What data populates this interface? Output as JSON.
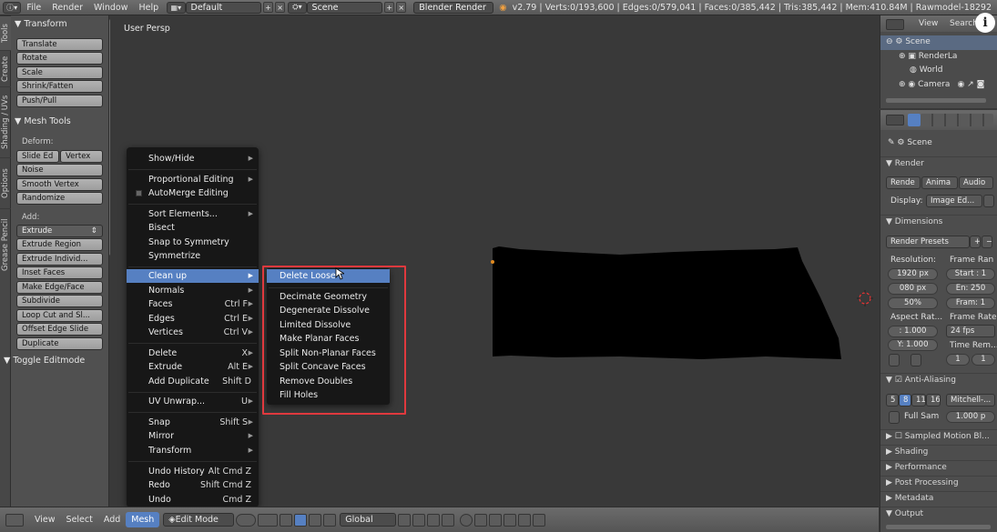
{
  "topbar": {
    "menus": [
      "File",
      "Render",
      "Window",
      "Help"
    ],
    "layout": "Default",
    "scene": "Scene",
    "engine": "Blender Render",
    "stats": "v2.79 | Verts:0/193,600 | Edges:0/579,041 | Faces:0/385,442 | Tris:385,442 | Mem:410.84M | Rawmodel-18292"
  },
  "sidetabs": [
    "Tools",
    "Create",
    "Shading / UVs",
    "Options",
    "Grease Pencil"
  ],
  "toolshelf": {
    "transform_header": "Transform",
    "transform_buttons": [
      "Translate",
      "Rotate",
      "Scale",
      "Shrink/Fatten",
      "Push/Pull"
    ],
    "meshtools_header": "Mesh Tools",
    "deform_label": "Deform:",
    "deform_pair": [
      "Slide Ed",
      "Vertex"
    ],
    "deform_buttons": [
      "Noise",
      "Smooth Vertex",
      "Randomize"
    ],
    "add_label": "Add:",
    "add_selected": "Extrude",
    "add_buttons": [
      "Extrude Region",
      "Extrude Individ...",
      "Inset Faces",
      "Make Edge/Face",
      "Subdivide",
      "Loop Cut and Sl...",
      "Offset Edge Slide",
      "Duplicate"
    ],
    "toggle_editmode": "Toggle Editmode"
  },
  "viewport": {
    "label": "User Persp"
  },
  "mesh_menu": {
    "items": [
      {
        "label": "Show/Hide",
        "shortcut": "",
        "submenu": true
      },
      {
        "label": "Proportional Editing",
        "shortcut": "",
        "submenu": true
      },
      {
        "label": "AutoMerge Editing",
        "shortcut": "",
        "submenu": false
      },
      {
        "label": "Sort Elements...",
        "shortcut": "",
        "submenu": true
      },
      {
        "label": "Bisect",
        "shortcut": "",
        "submenu": false
      },
      {
        "label": "Snap to Symmetry",
        "shortcut": "",
        "submenu": false
      },
      {
        "label": "Symmetrize",
        "shortcut": "",
        "submenu": false
      },
      {
        "label": "Clean up",
        "shortcut": "",
        "submenu": true
      },
      {
        "label": "Normals",
        "shortcut": "",
        "submenu": true
      },
      {
        "label": "Faces",
        "shortcut": "Ctrl F",
        "submenu": true
      },
      {
        "label": "Edges",
        "shortcut": "Ctrl E",
        "submenu": true
      },
      {
        "label": "Vertices",
        "shortcut": "Ctrl V",
        "submenu": true
      },
      {
        "label": "Delete",
        "shortcut": "X",
        "submenu": true
      },
      {
        "label": "Extrude",
        "shortcut": "Alt E",
        "submenu": true
      },
      {
        "label": "Add Duplicate",
        "shortcut": "Shift D",
        "submenu": false
      },
      {
        "label": "UV Unwrap...",
        "shortcut": "U",
        "submenu": true
      },
      {
        "label": "Snap",
        "shortcut": "Shift S",
        "submenu": true
      },
      {
        "label": "Mirror",
        "shortcut": "",
        "submenu": true
      },
      {
        "label": "Transform",
        "shortcut": "",
        "submenu": true
      },
      {
        "label": "Undo History",
        "shortcut": "Alt Cmd Z",
        "submenu": false
      },
      {
        "label": "Redo",
        "shortcut": "Shift Cmd Z",
        "submenu": false
      },
      {
        "label": "Undo",
        "shortcut": "Cmd Z",
        "submenu": false
      }
    ]
  },
  "cleanup_menu": {
    "items": [
      "Delete Loose",
      "Decimate Geometry",
      "Degenerate Dissolve",
      "Limited Dissolve",
      "Make Planar Faces",
      "Split Non-Planar Faces",
      "Split Concave Faces",
      "Remove Doubles",
      "Fill Holes"
    ]
  },
  "bottombar": {
    "menus": [
      "View",
      "Select",
      "Add",
      "Mesh"
    ],
    "mode": "Edit Mode",
    "orientation": "Global"
  },
  "outliner": {
    "header_view": "View",
    "header_search": "Search",
    "items": [
      "Scene",
      "RenderLa",
      "World",
      "Camera"
    ]
  },
  "properties": {
    "scene_label": "Scene",
    "render_header": "Render",
    "render_buttons": [
      "Rende",
      "Anima",
      "Audio"
    ],
    "display_label": "Display:",
    "display_value": "Image Ed...",
    "dimensions_header": "Dimensions",
    "render_presets": "Render Presets",
    "resolution_label": "Resolution:",
    "frame_range_label": "Frame Ran",
    "res_x": "1920 px",
    "res_y": "080 px",
    "res_pct": "50%",
    "start": "Start : 1",
    "end": "En: 250",
    "frame": "Fram: 1",
    "aspect_label": "Aspect Rat...",
    "frame_rate_label": "Frame Rate:",
    "aspect_x": ": 1.000",
    "aspect_y": "Y: 1.000",
    "fps": "24 fps",
    "time_remap_label": "Time Rem...",
    "remap_old": "1",
    "remap_new": "1",
    "aa_header": "Anti-Aliasing",
    "aa_samples": [
      "5",
      "8",
      "11",
      "16"
    ],
    "aa_filter": "Mitchell-...",
    "full_sample": "Full Sam",
    "filter_size": "1.000 p",
    "motion_blur": "Sampled Motion Bl...",
    "sections": [
      "Shading",
      "Performance",
      "Post Processing",
      "Metadata",
      "Output"
    ]
  },
  "colors": {
    "accent": "#5680c2",
    "highlight_box": "#e0393e",
    "menu_bg": "#171717",
    "viewport_bg": "#393939"
  }
}
